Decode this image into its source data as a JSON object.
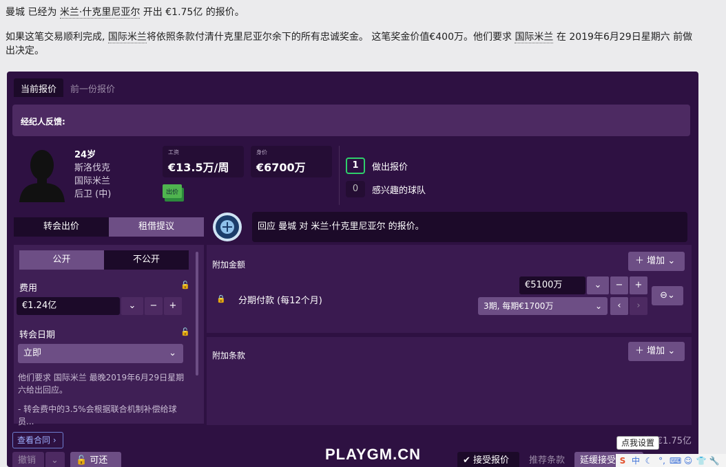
{
  "intro": {
    "line1_a": "曼城 已经为 ",
    "line1_player": "米兰·什克里尼亚尔",
    "line1_b": " 开出 €1.75亿 的报价。",
    "line2_a": "如果这笔交易顺利完成, ",
    "line2_club": "国际米兰",
    "line2_b": "将依照条款付清什克里尼亚尔余下的所有忠诚奖金。 这笔奖金价值€400万。他们要求 ",
    "line2_club2": "国际米兰",
    "line2_c": " 在 2019年6月29日星期六 前做出决定。"
  },
  "tabs": [
    "当前报价",
    "前一份报价"
  ],
  "agent_feedback": "经纪人反馈:",
  "player": {
    "age": "24岁",
    "nation": "斯洛伐克",
    "club": "国际米兰",
    "position": "后卫 (中)"
  },
  "stats": {
    "wage_label": "工资",
    "wage": "€13.5万/周",
    "value_label": "身价",
    "value": "€6700万",
    "bid_badge": "出价"
  },
  "offers": {
    "made_count": "1",
    "made_label": "做出报价",
    "interest_count": "0",
    "interest_label": "感兴趣的球队"
  },
  "offer_type": {
    "transfer": "转会出价",
    "loan": "租借提议"
  },
  "reply_text": "回应 曼城 对 米兰·什克里尼亚尔 的报价。",
  "visibility": {
    "public": "公开",
    "private": "不公开"
  },
  "fee": {
    "label": "费用",
    "value": "€1.24亿"
  },
  "date": {
    "label": "转会日期",
    "value": "立即"
  },
  "notes": {
    "n1": "他们要求 国际米兰 最晚2019年6月29日星期六给出回应。",
    "n2": "- 转会费中的3.5%会根据联合机制补偿给球员..."
  },
  "extra_amount": {
    "label": "附加金额",
    "add": "增加",
    "installment_label": "分期付款 (每12个月)",
    "installment_value": "€5100万",
    "installment_plan": "3期, 每期€1700万"
  },
  "extra_clauses": {
    "label": "附加条款",
    "add": "增加"
  },
  "contract_btn": "查看合同",
  "value_summary": "价值: €1.75亿",
  "bottom": {
    "cancel": "撤销",
    "negotiable": "可还价",
    "accept": "接受报价",
    "recommend": "推荐条款",
    "delay": "延缓接受"
  },
  "watermark": "PLAYGM.CN",
  "tooltip": "点我设置",
  "tray": {
    "ime": "中"
  }
}
